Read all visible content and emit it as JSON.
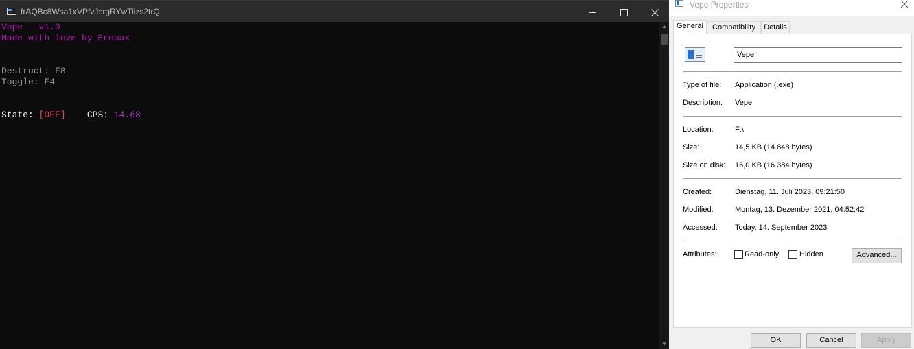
{
  "console": {
    "title": "frAQBc8Wsa1xVPfvJcrgRYwTiizs2trQ",
    "lines": {
      "version": "Vepe - v1.0",
      "credit": "Made with love by Erouax",
      "destruct": "Destruct: F8",
      "toggle": "Toggle: F4",
      "state_label": "State: ",
      "state_value": "[OFF]",
      "cps_label": "CPS: ",
      "cps_value": "14.68"
    },
    "icons": {
      "app": "console-app-icon",
      "minimize": "minimize-icon",
      "maximize": "maximize-icon",
      "close": "close-icon"
    }
  },
  "properties": {
    "title": "Vepe Properties",
    "tabs": [
      "General",
      "Compatibility",
      "Details"
    ],
    "file_name": "Vepe",
    "rows": {
      "type_label": "Type of file:",
      "type_value": "Application (.exe)",
      "desc_label": "Description:",
      "desc_value": "Vepe",
      "location_label": "Location:",
      "location_value": "F:\\",
      "size_label": "Size:",
      "size_value": "14,5 KB (14.848 bytes)",
      "disk_label": "Size on disk:",
      "disk_value": "16,0 KB (16.384 bytes)",
      "created_label": "Created:",
      "created_value": "Dienstag, 11. Juli 2023, 09:21:50",
      "modified_label": "Modified:",
      "modified_value": "Montag, 13. Dezember 2021, 04:52:42",
      "accessed_label": "Accessed:",
      "accessed_value": "Today, 14. September 2023",
      "attributes_label": "Attributes:"
    },
    "checkboxes": {
      "readonly": "Read-only",
      "hidden": "Hidden"
    },
    "buttons": {
      "advanced": "Advanced...",
      "ok": "OK",
      "cancel": "Cancel",
      "apply": "Apply"
    }
  },
  "colors": {
    "console_bg": "#0c0c0c",
    "magenta_text": "#b515b5",
    "off_red": "#e74856",
    "cps_purple": "#a23bbf",
    "dialog_bg": "#f0f0f0"
  }
}
